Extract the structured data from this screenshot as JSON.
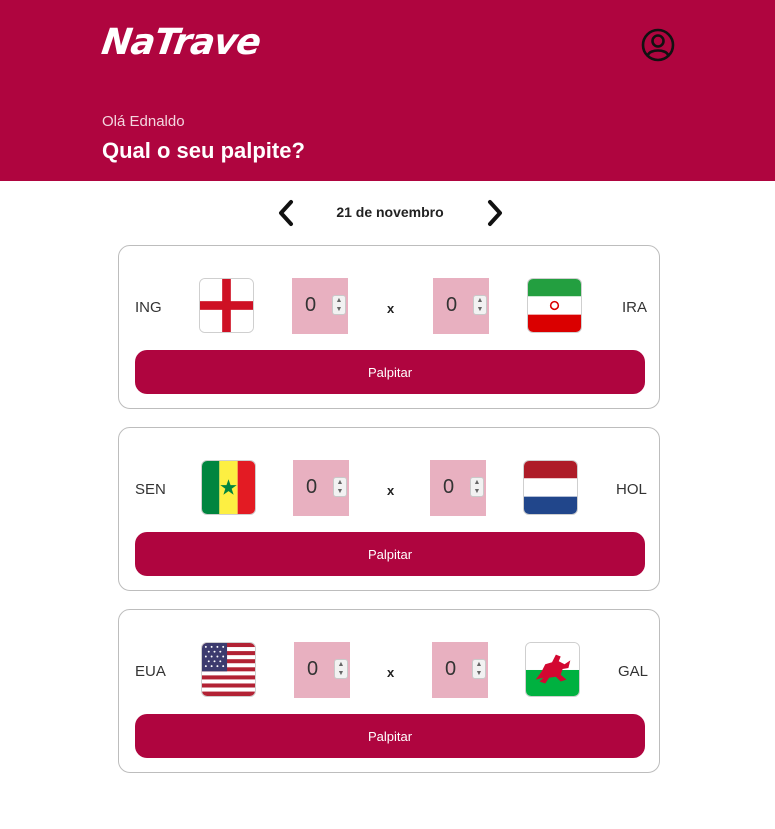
{
  "app": {
    "logo": "NaTrave"
  },
  "header": {
    "greeting": "Olá Ednaldo",
    "question": "Qual o seu palpite?"
  },
  "date_nav": {
    "date": "21 de novembro"
  },
  "matches": [
    {
      "home": {
        "code": "ING",
        "flag": "england-flag-icon",
        "score": "0"
      },
      "separator": "x",
      "away": {
        "code": "IRA",
        "flag": "iran-flag-icon",
        "score": "0"
      },
      "button": "Palpitar"
    },
    {
      "home": {
        "code": "SEN",
        "flag": "senegal-flag-icon",
        "score": "0"
      },
      "separator": "x",
      "away": {
        "code": "HOL",
        "flag": "netherlands-flag-icon",
        "score": "0"
      },
      "button": "Palpitar"
    },
    {
      "home": {
        "code": "EUA",
        "flag": "usa-flag-icon",
        "score": "0"
      },
      "separator": "x",
      "away": {
        "code": "GAL",
        "flag": "wales-flag-icon",
        "score": "0"
      },
      "button": "Palpitar"
    }
  ],
  "colors": {
    "brand": "#af053f",
    "score_bg": "#e8b0c0",
    "card_border": "#bdbdbd"
  }
}
